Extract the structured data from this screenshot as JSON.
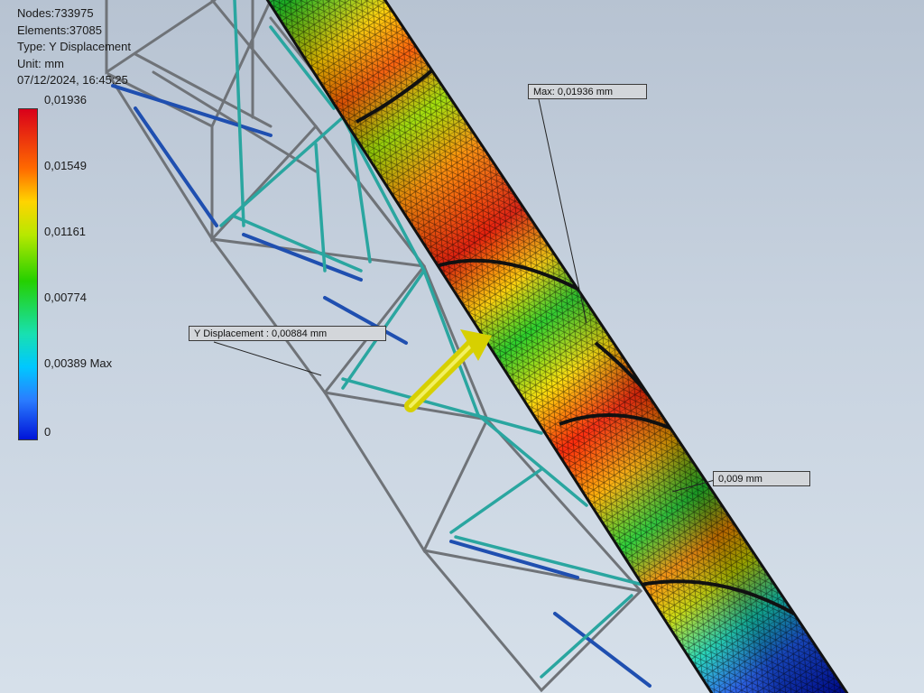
{
  "info": {
    "nodes": "Nodes:733975",
    "elements": "Elements:37085",
    "type": "Type: Y Displacement",
    "unit": "Unit: mm",
    "date": "07/12/2024, 16:45:25"
  },
  "legend": {
    "ticks": [
      "0,01936",
      "0,01549",
      "0,01161",
      "0,00774",
      "0,00389 Max",
      "0"
    ],
    "colors": [
      "#d9001a",
      "#ff6a00",
      "#ffd400",
      "#25d000",
      "#18e0b0",
      "#2a7dff",
      "#0014d8"
    ]
  },
  "callouts": {
    "max": "Max: 0,01936 mm",
    "probe1": "Y Displacement : 0,00884 mm",
    "probe2": "0,009 mm"
  },
  "colors": {
    "frame_gray": "#6f7378",
    "member_teal": "#2aa6a0",
    "member_blue": "#1f4fb0",
    "arrow_yellow": "#d7d000"
  }
}
